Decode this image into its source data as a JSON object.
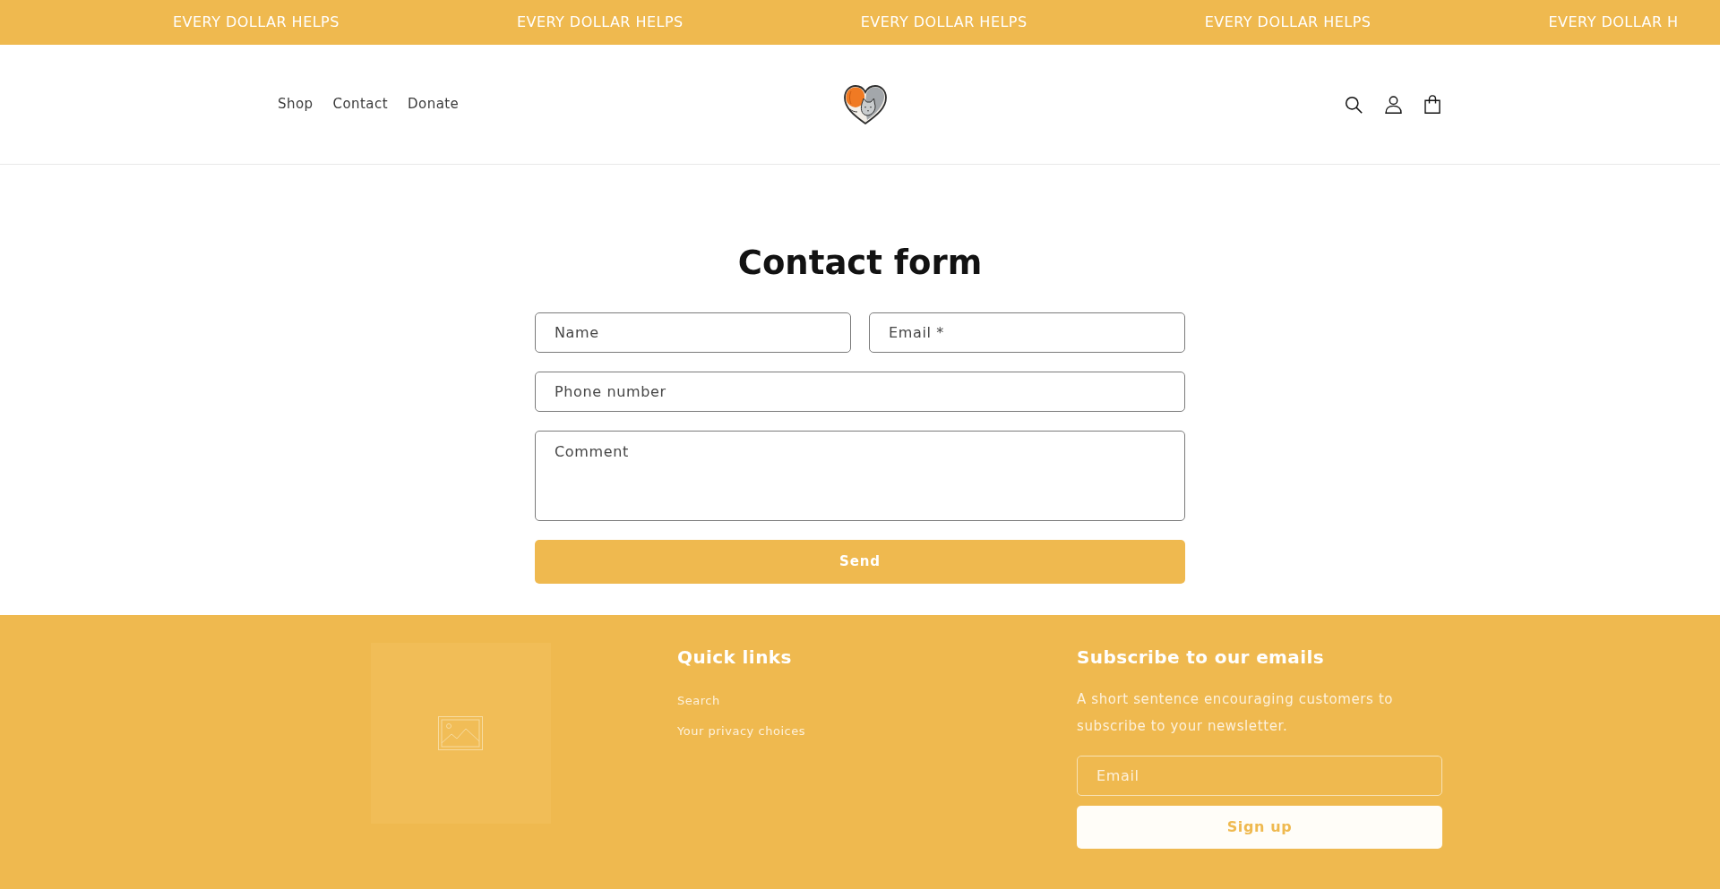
{
  "announcement_bar": {
    "messages": [
      "EVERY DOLLAR HELPS",
      "EVERY DOLLAR HELPS",
      "EVERY DOLLAR HELPS",
      "EVERY DOLLAR HELPS",
      "EVERY DOLLAR H"
    ]
  },
  "header": {
    "nav": [
      "Shop",
      "Contact",
      "Donate"
    ]
  },
  "contact_form": {
    "title": "Contact form",
    "fields": [
      {
        "kind": "half",
        "placeholder": "Name"
      },
      {
        "kind": "half",
        "placeholder": "Email *"
      },
      {
        "kind": "full",
        "placeholder": "Phone number"
      },
      {
        "kind": "multiline",
        "placeholder": "Comment"
      }
    ],
    "submit": "Send"
  },
  "footer": {
    "quick_links": {
      "title": "Quick links",
      "links": [
        "Search",
        "Your privacy choices"
      ]
    },
    "newsletter": {
      "title": "Subscribe to our emails",
      "text": "A short sentence encouraging customers to subscribe to your newsletter.",
      "email": {
        "placeholder": "Email"
      },
      "button": "Sign up"
    }
  }
}
